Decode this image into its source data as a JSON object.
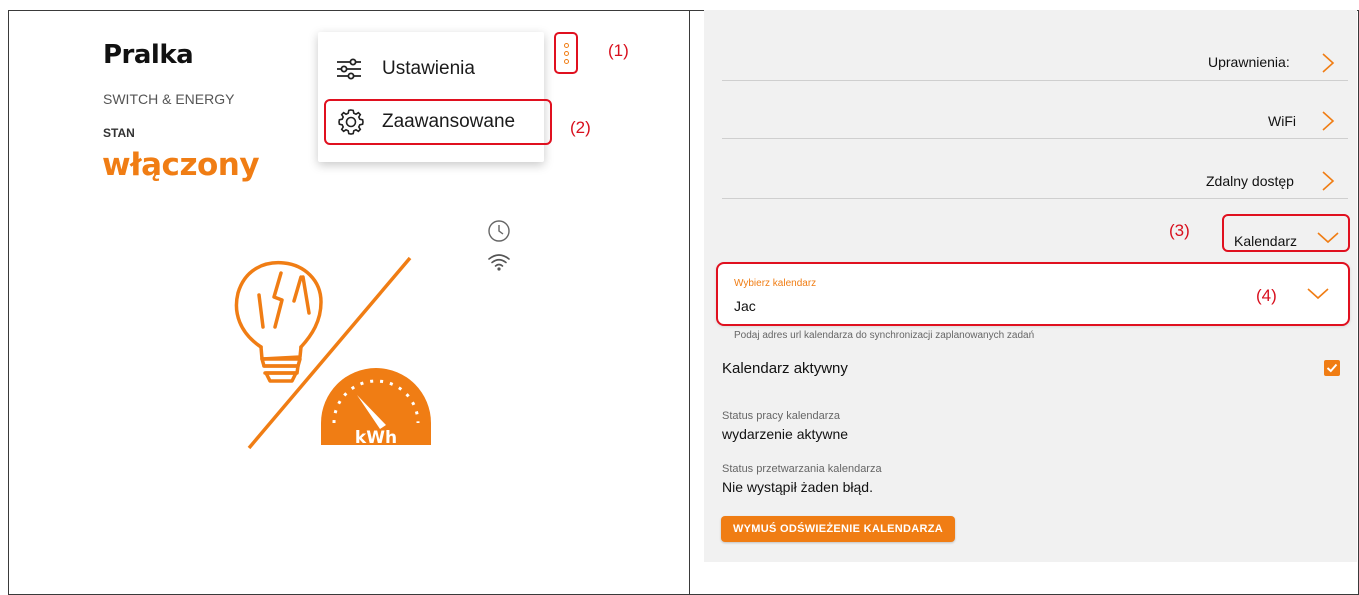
{
  "device": {
    "title": "Pralka",
    "subtitle": "SWITCH & ENERGY",
    "state_label": "STAN",
    "state_value": "włączony"
  },
  "menu": {
    "items": [
      {
        "label": "Ustawienia",
        "icon": "sliders-icon"
      },
      {
        "label": "Zaawansowane",
        "icon": "gear-icon"
      }
    ]
  },
  "markers": {
    "m1": "(1)",
    "m2": "(2)",
    "m3": "(3)",
    "m4": "(4)"
  },
  "illustration": {
    "meter_label": "kWh"
  },
  "settings": {
    "rows": [
      {
        "label": "Uprawnienia:"
      },
      {
        "label": "WiFi"
      },
      {
        "label": "Zdalny dostęp"
      },
      {
        "label": "Kalendarz"
      }
    ]
  },
  "calendar": {
    "select_label": "Wybierz kalendarz",
    "select_value": "Jac",
    "hint": "Podaj adres url kalendarza do synchronizacji zaplanowanych zadań",
    "active_label": "Kalendarz aktywny",
    "active_checked": true,
    "work_status_label": "Status pracy kalendarza",
    "work_status_value": "wydarzenie aktywne",
    "process_status_label": "Status przetwarzania kalendarza",
    "process_status_value": "Nie wystąpił żaden błąd.",
    "refresh_button": "WYMUŚ ODŚWIEŻENIE KALENDARZA"
  },
  "colors": {
    "accent": "#f07d14",
    "highlight": "#e0101f"
  }
}
